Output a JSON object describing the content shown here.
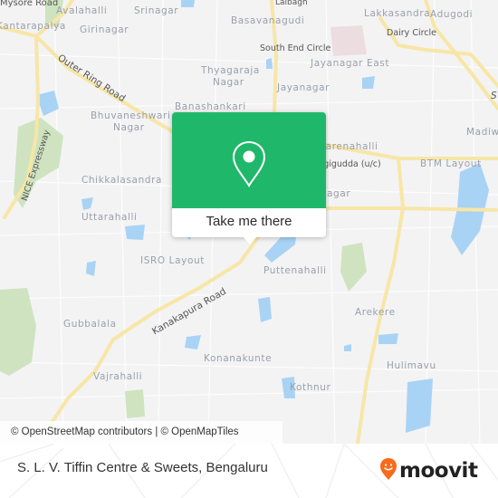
{
  "map": {
    "labels": {
      "mysore_road": "Mysore Road",
      "avalahalli": "Avalahalli",
      "srinagar": "Srinagar",
      "basavanagudi": "Basavanagudi",
      "lalbagh": "Lalbagh",
      "lakkasandra": "Lakkasandra",
      "adugodi": "Adugodi",
      "dairy_circle": "Dairy Circle",
      "nayandahalli": "Kantarapalya",
      "girinagar": "Girinagar",
      "south_end_circle": "South End Circle",
      "jayanagar_east": "Jayanagar East",
      "outer_ring_road": "Outer Ring Road",
      "thyagaraja_nagar": "Thyagaraja",
      "thyagaraja_nagar_2": "Nagar",
      "jayanagar": "Jayanagar",
      "banashankari": "Banashankari",
      "bhuvaneshwari": "Bhuvaneshwari",
      "bhuvaneshwari_2": "Nagar",
      "marenahalli": "Marenahalli",
      "ragigudda": "Ragigudda (u/c)",
      "btm_layout": "BTM Layout",
      "madiwala": "Madiwala",
      "nice_expressway": "NICE Expressway",
      "chikkalasandra": "Chikkalasandra",
      "jp_nagar": "JP Nagar",
      "uttarahalli": "Uttarahalli",
      "isro_layout": "ISRO Layout",
      "puttenahalli": "Puttenahalli",
      "kanakapura_road": "Kanakapura Road",
      "gubbalala": "Gubbalala",
      "arekere": "Arekere",
      "konanakunte": "Konanakunte",
      "hulimavu": "Hulimavu",
      "vajrahalli": "Vajrahalli",
      "kothnur": "Kothnur",
      "sarjapur": "S"
    },
    "attribution": "© OpenStreetMap contributors | © OpenMapTiles",
    "colors": {
      "background": "#f3f3f4",
      "major_road": "#f7e6a6",
      "water": "#a9d3f5",
      "park": "#cfe3c0",
      "pin_popup": "#1fb86a"
    }
  },
  "popup": {
    "cta_label": "Take me there",
    "icon": "location-pin-icon"
  },
  "footer": {
    "place_title": "S. L. V. Tiffin Centre & Sweets, Bengaluru",
    "brand": "moovit",
    "brand_color": "#f76b1c"
  }
}
